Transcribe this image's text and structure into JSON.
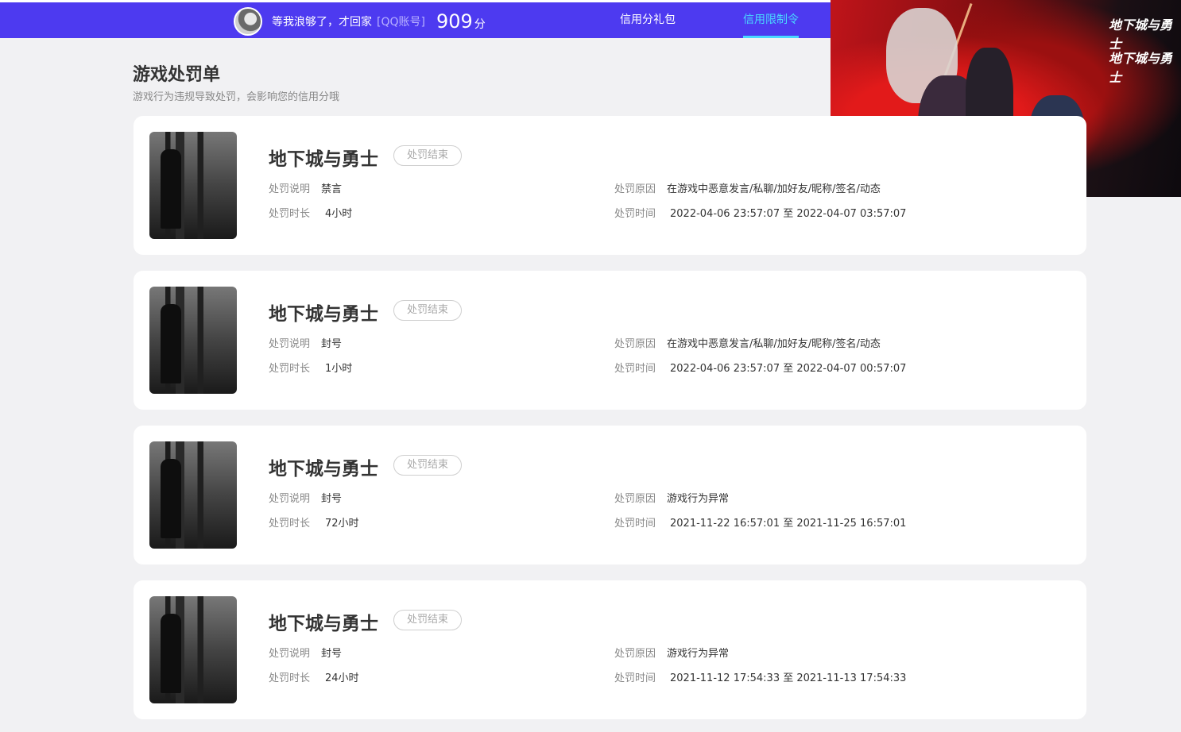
{
  "header": {
    "username": "等我浪够了，才回家",
    "account_type": "[QQ账号]",
    "score": "909",
    "score_unit": "分",
    "nav": [
      {
        "label": "信用分礼包"
      },
      {
        "label": "信用限制令",
        "active": true
      }
    ]
  },
  "banner": {
    "logo_text": "地下城与勇士"
  },
  "page": {
    "title": "游戏处罚单",
    "subtitle": "游戏行为违规导致处罚，会影响您的信用分哦"
  },
  "labels": {
    "desc": "处罚说明",
    "duration": "处罚时长",
    "reason": "处罚原因",
    "time": "处罚时间"
  },
  "cards": [
    {
      "game": "地下城与勇士",
      "status": "处罚结束",
      "desc": "禁言",
      "duration": "4小时",
      "reason": "在游戏中恶意发言/私聊/加好友/昵称/签名/动态",
      "time": "2022-04-06 23:57:07 至 2022-04-07 03:57:07"
    },
    {
      "game": "地下城与勇士",
      "status": "处罚结束",
      "desc": "封号",
      "duration": "1小时",
      "reason": "在游戏中恶意发言/私聊/加好友/昵称/签名/动态",
      "time": "2022-04-06 23:57:07 至 2022-04-07 00:57:07"
    },
    {
      "game": "地下城与勇士",
      "status": "处罚结束",
      "desc": "封号",
      "duration": "72小时",
      "reason": "游戏行为异常",
      "time": "2021-11-22 16:57:01 至 2021-11-25 16:57:01"
    },
    {
      "game": "地下城与勇士",
      "status": "处罚结束",
      "desc": "封号",
      "duration": "24小时",
      "reason": "游戏行为异常",
      "time": "2021-11-12 17:54:33 至 2021-11-13 17:54:33"
    }
  ],
  "colors": {
    "header_bg": "#4d3af0",
    "nav_active": "#49d8ff",
    "page_bg": "#f1f1f3"
  }
}
